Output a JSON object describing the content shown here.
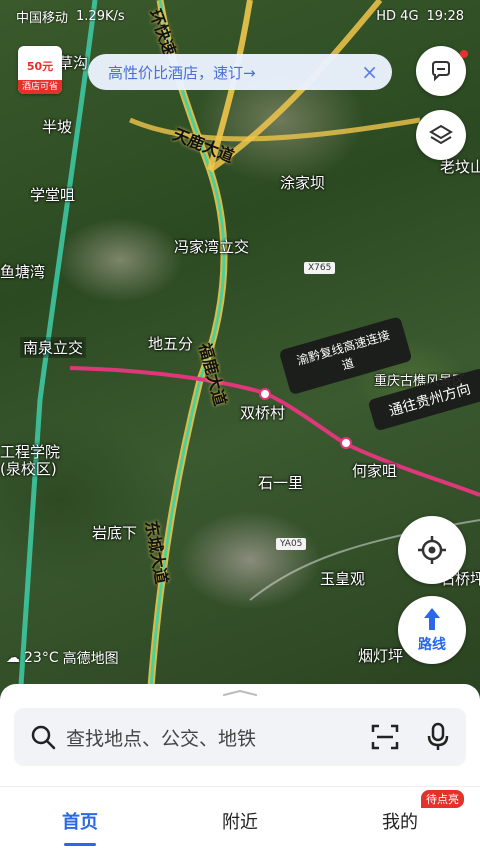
{
  "status_bar": {
    "carrier": "中国移动",
    "speed": "1.29K/s",
    "network": "HD 4G",
    "time": "19:28"
  },
  "promo": {
    "amount": "50元",
    "tag": "酒店可省"
  },
  "banner": {
    "text": "高性价比酒店，速订→"
  },
  "map": {
    "places": [
      {
        "name": "草沟"
      },
      {
        "name": "半坡"
      },
      {
        "name": "学堂咀"
      },
      {
        "name": "鱼塘湾"
      },
      {
        "name": "南泉立交"
      },
      {
        "name": "地五分"
      },
      {
        "name": "冯家湾立交"
      },
      {
        "name": "涂家坝"
      },
      {
        "name": "老坟山"
      },
      {
        "name": "双桥村"
      },
      {
        "name": "重庆古樵风景区"
      },
      {
        "name": "何家咀"
      },
      {
        "name": "石一里"
      },
      {
        "name": "工程学院"
      },
      {
        "name": "(泉校区)"
      },
      {
        "name": "岩底下"
      },
      {
        "name": "玉皇观"
      },
      {
        "name": "石桥坪"
      },
      {
        "name": "烟灯坪"
      }
    ],
    "roads": [
      {
        "name": "天鹿大道"
      },
      {
        "name": "福鹿大道"
      },
      {
        "name": "东城大道"
      },
      {
        "name": "环快速"
      }
    ],
    "shields": [
      "X765",
      "YA05"
    ],
    "callouts": [
      "渝黔复线高速连接道",
      "通往贵州方向"
    ]
  },
  "weather": {
    "temp": "23°C",
    "provider": "高德地图"
  },
  "search": {
    "placeholder": "查找地点、公交、地铁"
  },
  "route_button": {
    "label": "路线"
  },
  "nav": {
    "items": [
      {
        "label": "首页",
        "active": true
      },
      {
        "label": "附近",
        "active": false
      },
      {
        "label": "我的",
        "active": false
      }
    ],
    "badge": "待点亮"
  },
  "colors": {
    "accent": "#2a68e8",
    "route": "#e0367a",
    "badge": "#e6302a"
  }
}
